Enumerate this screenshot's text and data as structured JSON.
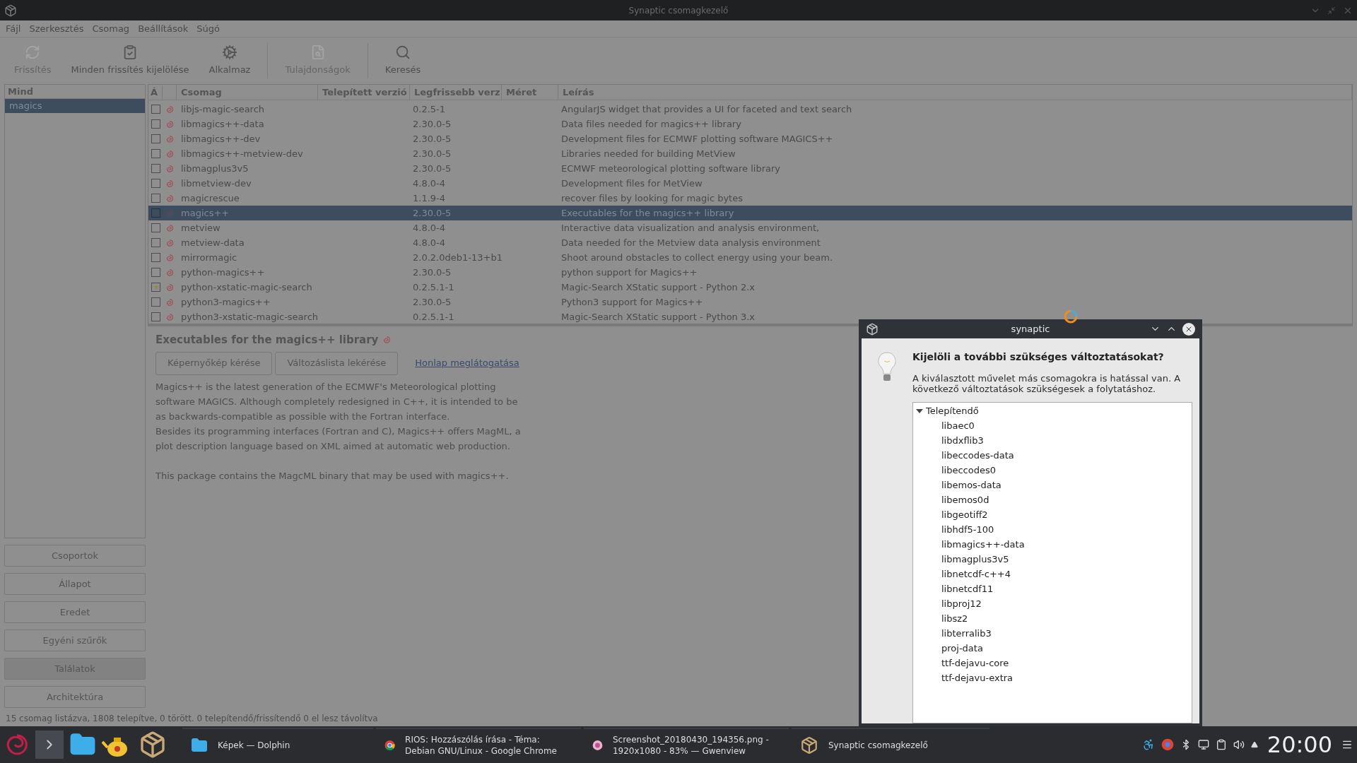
{
  "window": {
    "title": "Synaptic csomagkezelő"
  },
  "menu": [
    "Fájl",
    "Szerkesztés",
    "Csomag",
    "Beállítások",
    "Súgó"
  ],
  "toolbar": [
    {
      "label": "Frissítés",
      "kind": "refresh",
      "disabled": true
    },
    {
      "label": "Minden frissítés kijelölése",
      "kind": "mark",
      "disabled": false
    },
    {
      "label": "Alkalmaz",
      "kind": "apply",
      "disabled": false
    },
    {
      "label": "Tulajdonságok",
      "kind": "properties",
      "disabled": true
    },
    {
      "label": "Keresés",
      "kind": "search",
      "disabled": false
    }
  ],
  "filter_list": {
    "header": "Mind",
    "items": [
      {
        "label": "magics",
        "selected": true
      }
    ]
  },
  "filter_buttons": [
    {
      "label": "Csoportok",
      "selected": false
    },
    {
      "label": "Állapot",
      "selected": false
    },
    {
      "label": "Eredet",
      "selected": false
    },
    {
      "label": "Egyéni szűrők",
      "selected": false
    },
    {
      "label": "Találatok",
      "selected": true
    },
    {
      "label": "Architektúra",
      "selected": false
    }
  ],
  "table": {
    "columns": [
      "Á",
      "Csomag",
      "Telepített verzió",
      "Legfrissebb verz",
      "Méret",
      "Leírás"
    ],
    "rows": [
      {
        "kind": "plain",
        "name": "libjs-magic-search",
        "latest": "0.2.5-1",
        "description": "AngularJS widget that provides a UI for faceted and text search",
        "selected": false
      },
      {
        "kind": "plain",
        "name": "libmagics++-data",
        "latest": "2.30.0-5",
        "description": "Data files needed for magics++ library",
        "selected": false
      },
      {
        "kind": "plain",
        "name": "libmagics++-dev",
        "latest": "2.30.0-5",
        "description": "Development files for ECMWF  plotting software MAGICS++",
        "selected": false
      },
      {
        "kind": "plain",
        "name": "libmagics++-metview-dev",
        "latest": "2.30.0-5",
        "description": "Libraries needed for building MetView",
        "selected": false
      },
      {
        "kind": "plain",
        "name": "libmagplus3v5",
        "latest": "2.30.0-5",
        "description": "ECMWF meteorological plotting software library",
        "selected": false
      },
      {
        "kind": "plain",
        "name": "libmetview-dev",
        "latest": "4.8.0-4",
        "description": "Development files for MetView",
        "selected": false
      },
      {
        "kind": "plain",
        "name": "magicrescue",
        "latest": "1.1.9-4",
        "description": "recover files by looking for magic bytes",
        "selected": false
      },
      {
        "kind": "plain",
        "name": "magics++",
        "latest": "2.30.0-5",
        "description": "Executables for the magics++ library",
        "selected": true
      },
      {
        "kind": "plain",
        "name": "metview",
        "latest": "4.8.0-4",
        "description": "Interactive data visualization and analysis environment,",
        "selected": false
      },
      {
        "kind": "plain",
        "name": "metview-data",
        "latest": "4.8.0-4",
        "description": "Data needed for the Metview data analysis environment",
        "selected": false
      },
      {
        "kind": "plain",
        "name": "mirrormagic",
        "latest": "2.0.2.0deb1-13+b1",
        "description": "Shoot around obstacles to collect energy using your beam.",
        "selected": false
      },
      {
        "kind": "plain",
        "name": "python-magics++",
        "latest": "2.30.0-5",
        "description": "python support for Magics++",
        "selected": false
      },
      {
        "kind": "new",
        "name": "python-xstatic-magic-search",
        "latest": "0.2.5.1-1",
        "description": "Magic-Search XStatic support - Python 2.x",
        "selected": false
      },
      {
        "kind": "plain",
        "name": "python3-magics++",
        "latest": "2.30.0-5",
        "description": "Python3 support for Magics++",
        "selected": false
      },
      {
        "kind": "plain",
        "name": "python3-xstatic-magic-search",
        "latest": "0.2.5.1-1",
        "description": "Magic-Search XStatic support - Python 3.x",
        "selected": false
      }
    ]
  },
  "details": {
    "title": "Executables for the magics++ library",
    "buttons": [
      "Képernyőkép kérése",
      "Változáslista lekérése"
    ],
    "link": "Honlap meglátogatása",
    "paragraphs": [
      "Magics++ is the latest generation of the ECMWF's Meteorological plotting software MAGICS. Although completely redesigned in C++, it is intended to be as backwards-compatible as possible with the Fortran interface.\nBesides its programming interfaces (Fortran and C), Magics++ offers MagML, a plot description language based on XML aimed at automatic web production.",
      "This package contains the MagcML binary that may be used with magics++."
    ]
  },
  "status_bar": "15 csomag listázva, 1808 telepítve, 0 törött. 0 telepítendő/frissítendő 0 el lesz távolítva",
  "dialog": {
    "title": "synaptic",
    "heading": "Kijelöli a további szükséges változtatásokat?",
    "message": "A kiválasztott művelet más csomagokra is hatással van. A következő változtatások szükségesek a folytatáshoz.",
    "tree": [
      {
        "label": "Telepítendő",
        "expanded": true,
        "children": [
          {
            "label": "libaec0"
          },
          {
            "label": "libdxflib3"
          },
          {
            "label": "libeccodes-data"
          },
          {
            "label": "libeccodes0"
          },
          {
            "label": "libemos-data"
          },
          {
            "label": "libemos0d"
          },
          {
            "label": "libgeotiff2"
          },
          {
            "label": "libhdf5-100"
          },
          {
            "label": "libmagics++-data"
          },
          {
            "label": "libmagplus3v5"
          },
          {
            "label": "libnetcdf-c++4"
          },
          {
            "label": "libnetcdf11"
          },
          {
            "label": "libproj12"
          },
          {
            "label": "libsz2"
          },
          {
            "label": "libterralib3"
          },
          {
            "label": "proj-data"
          },
          {
            "label": "ttf-dejavu-core"
          },
          {
            "label": "ttf-dejavu-extra"
          }
        ]
      }
    ]
  },
  "taskbar": {
    "tasks": [
      {
        "label": "Képek — Dolphin",
        "kind": "folder"
      },
      {
        "label": "RIOS: Hozzászólás írása - Téma: Debian GNU/Linux - Google Chrome",
        "kind": "browser"
      },
      {
        "label": "Screenshot_20180430_194356.png - 1920x1080 - 83% — Gwenview",
        "kind": "viewer"
      },
      {
        "label": "Synaptic csomagkezelő",
        "kind": "package"
      }
    ],
    "clock": "20:00"
  }
}
